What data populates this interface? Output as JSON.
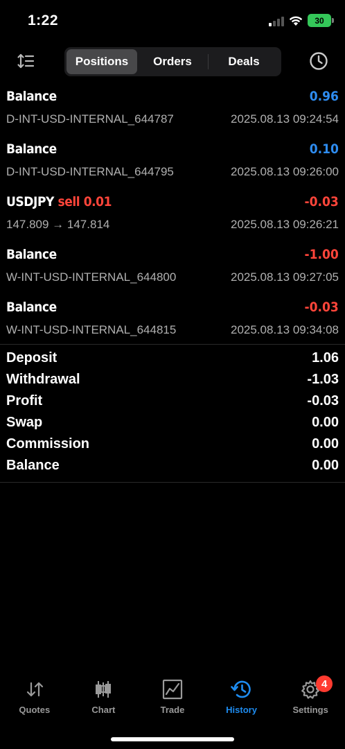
{
  "status_bar": {
    "time": "1:22",
    "battery": "30"
  },
  "header": {
    "sort_icon": "sort-icon",
    "tabs": [
      {
        "label": "Positions",
        "active": true
      },
      {
        "label": "Orders",
        "active": false
      },
      {
        "label": "Deals",
        "active": false
      }
    ],
    "history_icon": "clock-icon"
  },
  "deals": [
    {
      "title": "Balance",
      "type": "",
      "amount": "0.96",
      "comment": "D-INT-USD-INTERNAL_644787",
      "time": "2025.08.13 09:24:54"
    },
    {
      "title": "Balance",
      "type": "",
      "amount": "0.10",
      "comment": "D-INT-USD-INTERNAL_644795",
      "time": "2025.08.13 09:26:00"
    },
    {
      "title": "USDJPY",
      "type": "sell 0.01",
      "amount": "-0.03",
      "comment": "147.809 → 147.814",
      "time": "2025.08.13 09:26:21"
    },
    {
      "title": "Balance",
      "type": "",
      "amount": "-1.00",
      "comment": "W-INT-USD-INTERNAL_644800",
      "time": "2025.08.13 09:27:05"
    },
    {
      "title": "Balance",
      "type": "",
      "amount": "-0.03",
      "comment": "W-INT-USD-INTERNAL_644815",
      "time": "2025.08.13 09:34:08"
    }
  ],
  "summary": [
    {
      "label": "Deposit",
      "value": "1.06"
    },
    {
      "label": "Withdrawal",
      "value": "-1.03"
    },
    {
      "label": "Profit",
      "value": "-0.03"
    },
    {
      "label": "Swap",
      "value": "0.00"
    },
    {
      "label": "Commission",
      "value": "0.00"
    },
    {
      "label": "Balance",
      "value": "0.00"
    }
  ],
  "tabbar": [
    {
      "label": "Quotes",
      "icon": "quotes-icon",
      "active": false
    },
    {
      "label": "Chart",
      "icon": "chart-icon",
      "active": false
    },
    {
      "label": "Trade",
      "icon": "trade-icon",
      "active": false
    },
    {
      "label": "History",
      "icon": "history-icon",
      "active": true
    },
    {
      "label": "Settings",
      "icon": "gear-icon",
      "active": false,
      "badge": "4"
    }
  ],
  "colors": {
    "positive": "#2e8cf0",
    "negative": "#ff453a",
    "accent": "#1e8cf0",
    "badge": "#ff3b30"
  }
}
